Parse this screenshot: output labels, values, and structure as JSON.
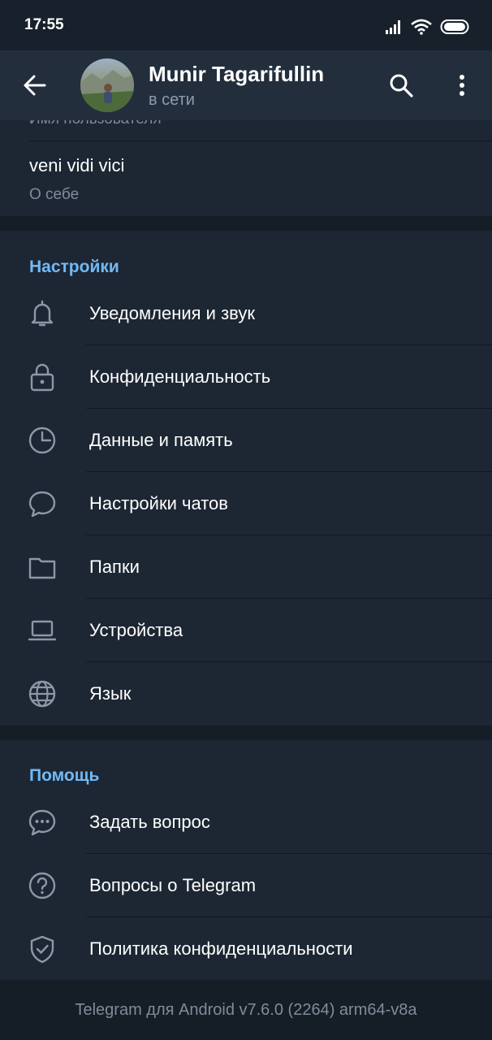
{
  "status_bar": {
    "time": "17:55"
  },
  "header": {
    "name": "Munir Tagarifullin",
    "status": "в сети"
  },
  "profile": {
    "username_label": "Имя пользователя",
    "bio_value": "veni vidi vici",
    "bio_label": "О себе"
  },
  "settings": {
    "title": "Настройки",
    "items": [
      {
        "label": "Уведомления и звук",
        "icon": "bell-icon"
      },
      {
        "label": "Конфиденциальность",
        "icon": "lock-icon"
      },
      {
        "label": "Данные и память",
        "icon": "clock-icon"
      },
      {
        "label": "Настройки чатов",
        "icon": "chat-bubble-icon"
      },
      {
        "label": "Папки",
        "icon": "folder-icon"
      },
      {
        "label": "Устройства",
        "icon": "laptop-icon"
      },
      {
        "label": "Язык",
        "icon": "globe-icon"
      }
    ]
  },
  "help": {
    "title": "Помощь",
    "items": [
      {
        "label": "Задать вопрос",
        "icon": "chat-dots-icon"
      },
      {
        "label": "Вопросы о Telegram",
        "icon": "question-icon"
      },
      {
        "label": "Политика конфиденциальности",
        "icon": "shield-check-icon"
      }
    ]
  },
  "footer": {
    "version": "Telegram для Android v7.6.0 (2264) arm64-v8a"
  },
  "colors": {
    "background": "#1d2733",
    "header_bg": "#232e3c",
    "accent": "#71baf7",
    "secondary_text": "#7e8c9b"
  }
}
